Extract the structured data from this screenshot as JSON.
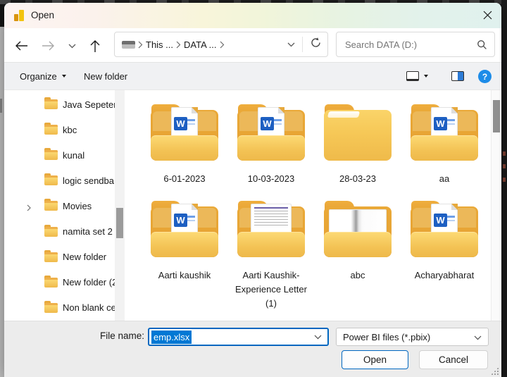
{
  "window": {
    "title": "Open"
  },
  "nav": {
    "crumb1": "This ...",
    "crumb2": "DATA ...",
    "search_text": "Search DATA (D:)"
  },
  "toolbar": {
    "organize": "Organize",
    "new_folder": "New folder",
    "help_glyph": "?"
  },
  "sidebar": {
    "items": [
      {
        "label": "Java Sepetem"
      },
      {
        "label": "kbc"
      },
      {
        "label": "kunal"
      },
      {
        "label": "logic sendba"
      },
      {
        "label": "Movies",
        "expander": true
      },
      {
        "label": "namita set 2"
      },
      {
        "label": "New folder"
      },
      {
        "label": "New folder (2"
      },
      {
        "label": "Non blank ce"
      }
    ]
  },
  "files": {
    "word_glyph": "W",
    "items": [
      {
        "name": "6-01-2023",
        "icon": "folder-with-word-doc"
      },
      {
        "name": "10-03-2023",
        "icon": "folder-with-word-doc"
      },
      {
        "name": "28-03-23",
        "icon": "closed-folder"
      },
      {
        "name": "aa",
        "icon": "folder-with-word-doc"
      },
      {
        "name": "Aarti kaushik",
        "icon": "folder-with-word-doc"
      },
      {
        "name": "Aarti Kaushik-Experience Letter (1)",
        "icon": "folder-with-letter-doc"
      },
      {
        "name": "abc",
        "icon": "folder-with-sheets"
      },
      {
        "name": "Acharyabharat",
        "icon": "folder-with-word-doc"
      }
    ]
  },
  "footer": {
    "file_name_label": "File name:",
    "file_name_value": "emp.xlsx",
    "file_type_value": "Power BI files (*.pbix)",
    "open": "Open",
    "cancel": "Cancel"
  },
  "colors": {
    "accent": "#0067c0",
    "selection": "#0078d4",
    "folder_yellow": "#f2c14e",
    "help_blue": "#1d8ce8",
    "title_gradient_right": "#e0f1ee"
  }
}
